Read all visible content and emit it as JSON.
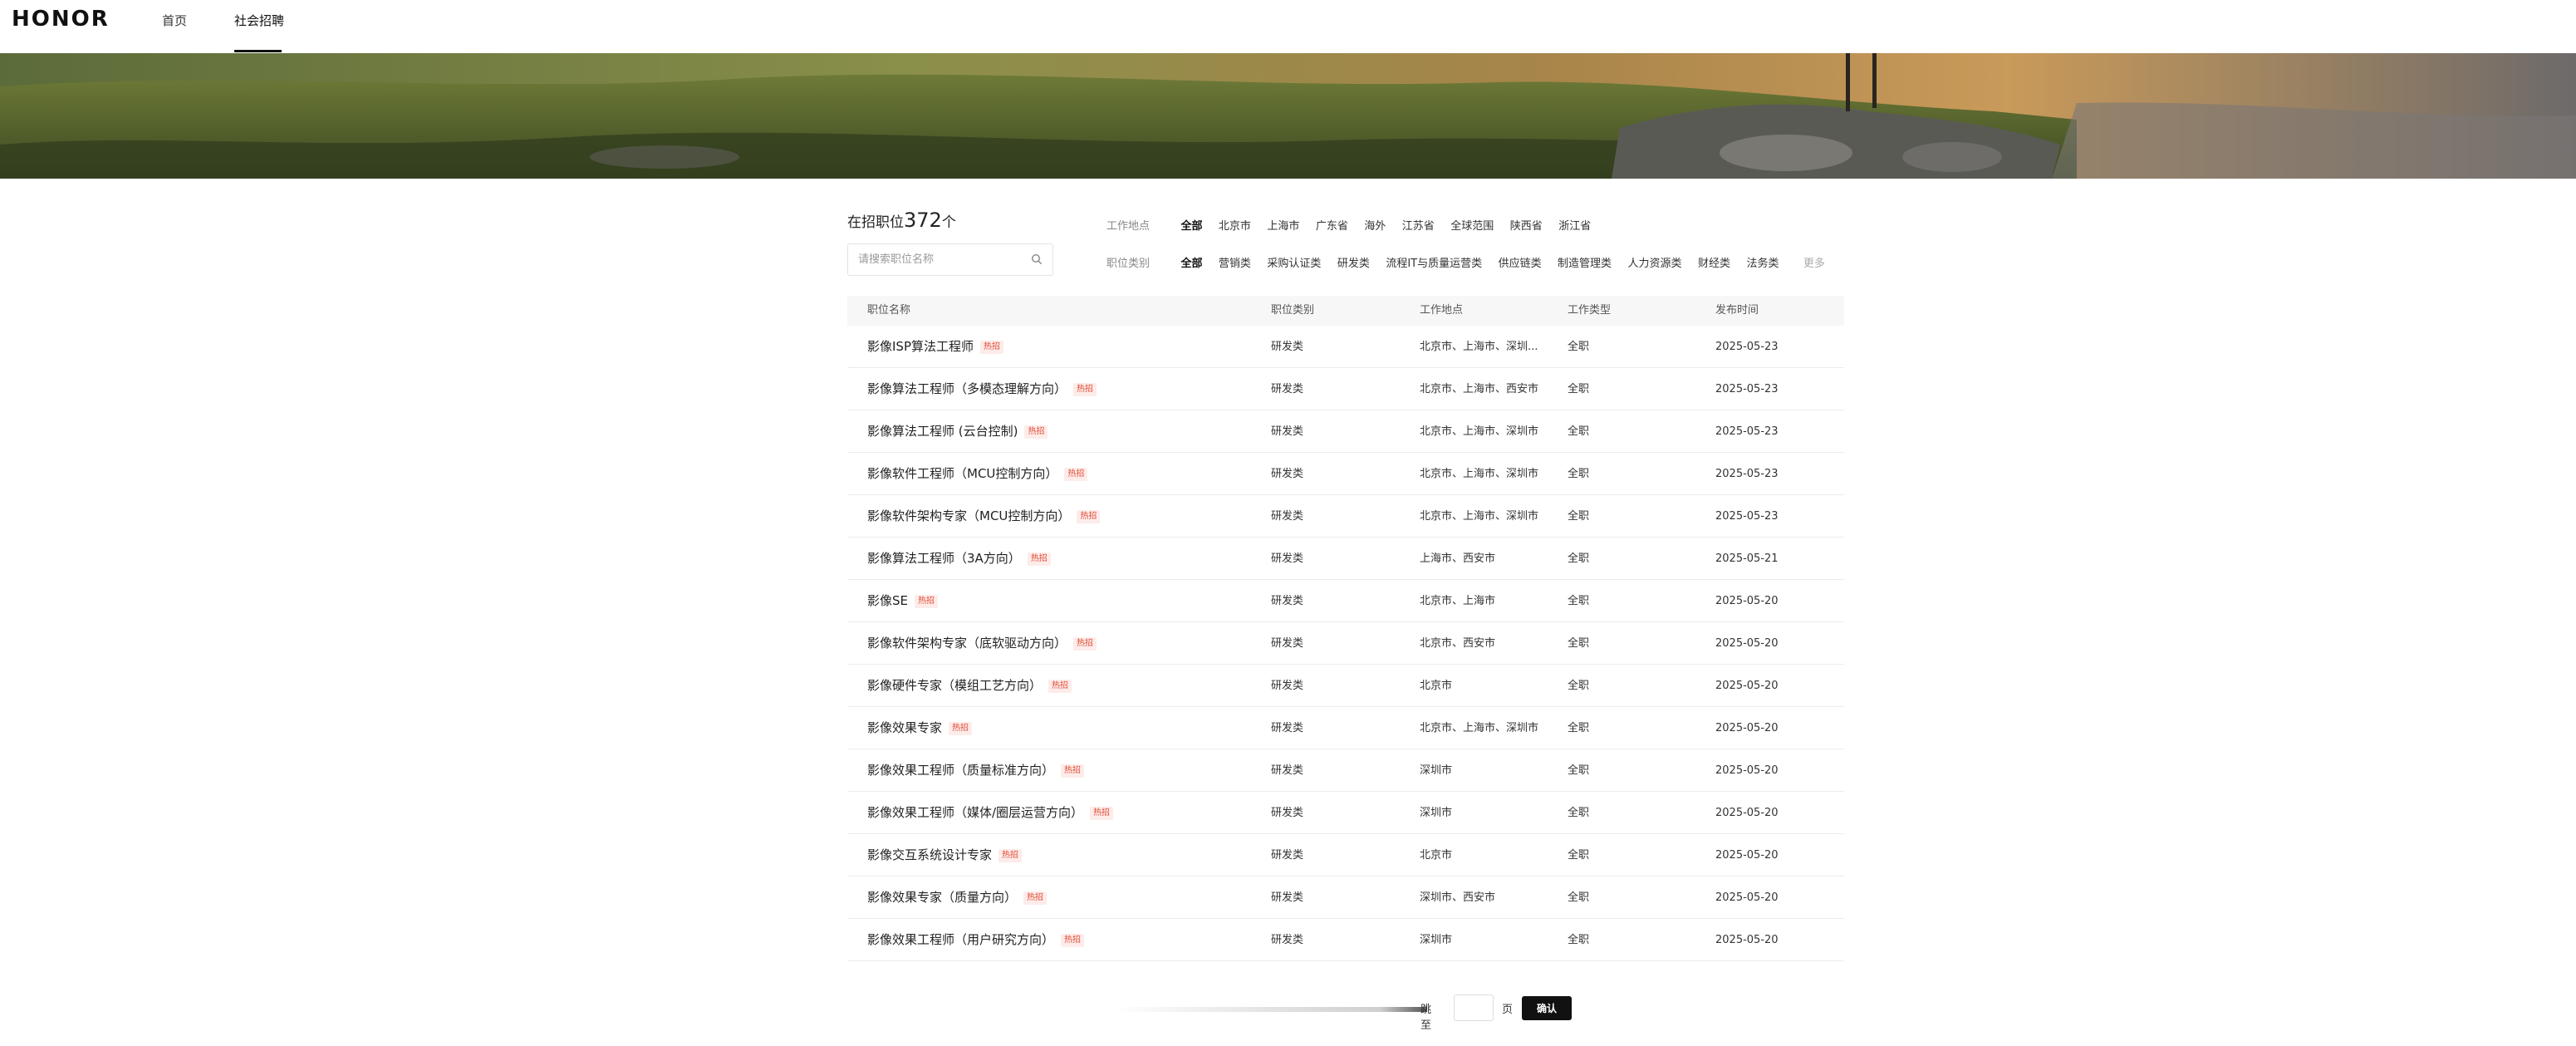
{
  "header": {
    "logo": "HONOR",
    "nav": [
      {
        "label": "首页"
      },
      {
        "label": "社会招聘"
      }
    ]
  },
  "summary": {
    "prefix": "在招职位",
    "count": "372",
    "suffix": "个"
  },
  "search": {
    "placeholder": "请搜索职位名称"
  },
  "filters": {
    "location": {
      "label": "工作地点",
      "options": [
        "全部",
        "北京市",
        "上海市",
        "广东省",
        "海外",
        "江苏省",
        "全球范围",
        "陕西省",
        "浙江省"
      ],
      "active": "全部"
    },
    "category": {
      "label": "职位类别",
      "options": [
        "全部",
        "营销类",
        "采购认证类",
        "研发类",
        "流程IT与质量运营类",
        "供应链类",
        "制造管理类",
        "人力资源类",
        "财经类",
        "法务类"
      ],
      "active": "全部",
      "more": "更多"
    }
  },
  "table": {
    "headers": {
      "name": "职位名称",
      "category": "职位类别",
      "location": "工作地点",
      "type": "工作类型",
      "date": "发布时间"
    },
    "hot_label": "热招",
    "rows": [
      {
        "name": "影像ISP算法工程师",
        "category": "研发类",
        "location": "北京市、上海市、深圳...",
        "type": "全职",
        "date": "2025-05-23"
      },
      {
        "name": "影像算法工程师（多模态理解方向）",
        "category": "研发类",
        "location": "北京市、上海市、西安市",
        "type": "全职",
        "date": "2025-05-23"
      },
      {
        "name": "影像算法工程师 (云台控制)",
        "category": "研发类",
        "location": "北京市、上海市、深圳市",
        "type": "全职",
        "date": "2025-05-23"
      },
      {
        "name": "影像软件工程师（MCU控制方向）",
        "category": "研发类",
        "location": "北京市、上海市、深圳市",
        "type": "全职",
        "date": "2025-05-23"
      },
      {
        "name": "影像软件架构专家（MCU控制方向）",
        "category": "研发类",
        "location": "北京市、上海市、深圳市",
        "type": "全职",
        "date": "2025-05-23"
      },
      {
        "name": "影像算法工程师（3A方向）",
        "category": "研发类",
        "location": "上海市、西安市",
        "type": "全职",
        "date": "2025-05-21"
      },
      {
        "name": "影像SE",
        "category": "研发类",
        "location": "北京市、上海市",
        "type": "全职",
        "date": "2025-05-20"
      },
      {
        "name": "影像软件架构专家（底软驱动方向）",
        "category": "研发类",
        "location": "北京市、西安市",
        "type": "全职",
        "date": "2025-05-20"
      },
      {
        "name": "影像硬件专家（模组工艺方向）",
        "category": "研发类",
        "location": "北京市",
        "type": "全职",
        "date": "2025-05-20"
      },
      {
        "name": "影像效果专家",
        "category": "研发类",
        "location": "北京市、上海市、深圳市",
        "type": "全职",
        "date": "2025-05-20"
      },
      {
        "name": "影像效果工程师（质量标准方向）",
        "category": "研发类",
        "location": "深圳市",
        "type": "全职",
        "date": "2025-05-20"
      },
      {
        "name": "影像效果工程师（媒体/圈层运营方向）",
        "category": "研发类",
        "location": "深圳市",
        "type": "全职",
        "date": "2025-05-20"
      },
      {
        "name": "影像交互系统设计专家",
        "category": "研发类",
        "location": "北京市",
        "type": "全职",
        "date": "2025-05-20"
      },
      {
        "name": "影像效果专家（质量方向）",
        "category": "研发类",
        "location": "深圳市、西安市",
        "type": "全职",
        "date": "2025-05-20"
      },
      {
        "name": "影像效果工程师（用户研究方向）",
        "category": "研发类",
        "location": "深圳市",
        "type": "全职",
        "date": "2025-05-20"
      }
    ]
  },
  "pager": {
    "jump_label": "跳至",
    "page_unit": "页",
    "confirm": "确认"
  }
}
